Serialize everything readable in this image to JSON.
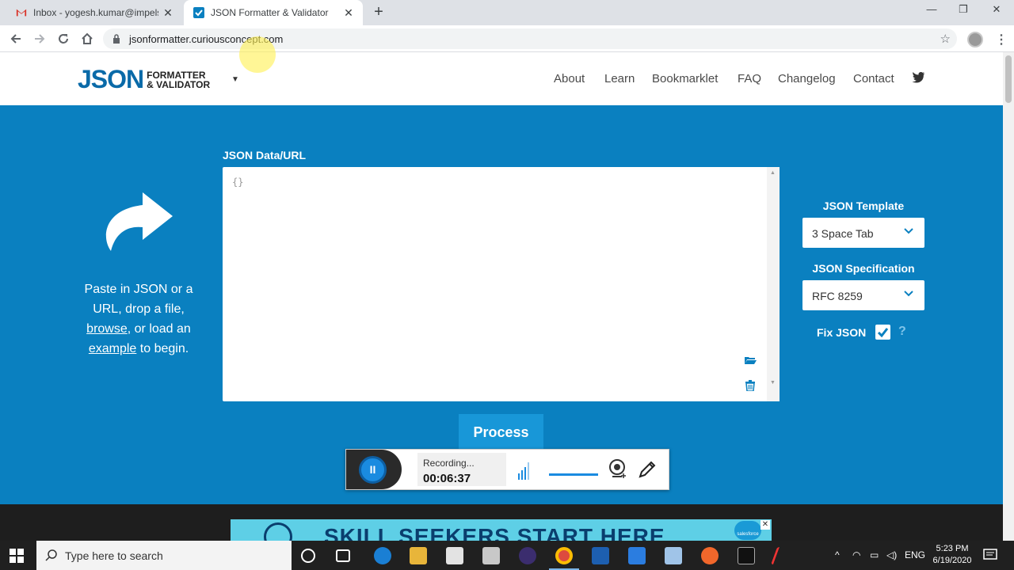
{
  "browser": {
    "tabs": [
      {
        "title": "Inbox - yogesh.kumar@impelsys",
        "active": false,
        "close": "✕"
      },
      {
        "title": "JSON Formatter & Validator",
        "active": true,
        "close": "✕"
      }
    ],
    "new_tab": "+",
    "window_controls": {
      "minimize": "—",
      "maximize": "❐",
      "close": "✕"
    },
    "url": "jsonformatter.curiousconcept.com",
    "bookmark_star": "☆",
    "menu": "⋮"
  },
  "site": {
    "logo_main": "JSON",
    "logo_line1": "FORMATTER",
    "logo_line2": "& VALIDATOR",
    "logo_caret": "▼",
    "nav": [
      "About",
      "Learn",
      "Bookmarklet",
      "FAQ",
      "Changelog",
      "Contact"
    ]
  },
  "main": {
    "intro_parts": [
      "Paste in JSON or a URL, drop a file, ",
      "browse",
      ", or load an ",
      "example",
      " to begin."
    ],
    "data_label": "JSON Data/URL",
    "editor_content": "{}",
    "template_label": "JSON Template",
    "template_value": "3 Space Tab",
    "spec_label": "JSON Specification",
    "spec_value": "RFC 8259",
    "fix_json_label": "Fix JSON",
    "fix_json_checked": true,
    "help": "?",
    "process_label": "Process"
  },
  "recorder": {
    "status": "Recording...",
    "elapsed": "00:06:37",
    "pause": "II"
  },
  "ad": {
    "headline": "SKILL SEEKERS START HERE",
    "close": "✕",
    "badge": "salesforce"
  },
  "taskbar": {
    "search_placeholder": "Type here to search",
    "language": "ENG",
    "time": "5:23 PM",
    "date": "6/19/2020"
  },
  "colors": {
    "brand_blue": "#0a80c0",
    "logo_blue": "#0a6aa8",
    "process_button": "#1897d8",
    "recorder_accent": "#1a8be0"
  }
}
